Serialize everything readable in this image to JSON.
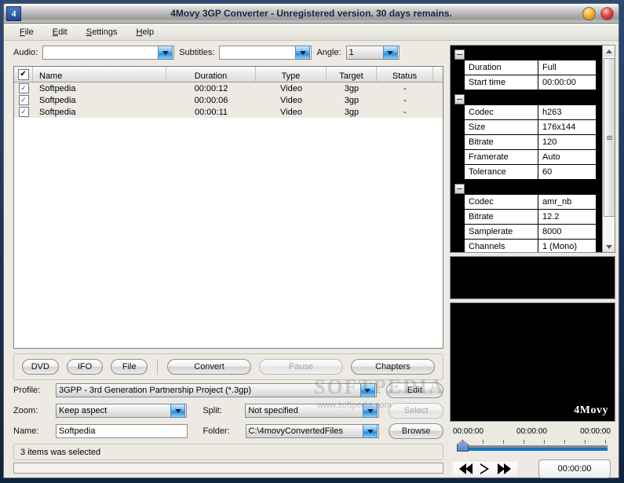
{
  "window": {
    "icon_label": "4",
    "title": "4Movy 3GP Converter - Unregistered version. 30 days remains.",
    "minimize_label": "",
    "close_label": ""
  },
  "menu": {
    "items": [
      {
        "pre": "",
        "accel": "F",
        "post": "ile"
      },
      {
        "pre": "",
        "accel": "E",
        "post": "dit"
      },
      {
        "pre": "",
        "accel": "S",
        "post": "ettings"
      },
      {
        "pre": "",
        "accel": "H",
        "post": "elp"
      }
    ]
  },
  "selectors": {
    "audio_label": "Audio:",
    "audio_value": "",
    "subtitles_label": "Subtitles:",
    "subtitles_value": "",
    "angle_label": "Angle:",
    "angle_value": "1"
  },
  "filelist": {
    "columns": [
      "Name",
      "Duration",
      "Type",
      "Target",
      "Status"
    ],
    "header_check": "✔",
    "rows": [
      {
        "checked": "✓",
        "name": "Softpedia",
        "duration": "00:00:12",
        "type": "Video",
        "target": "3gp",
        "status": "-"
      },
      {
        "checked": "✓",
        "name": "Softpedia",
        "duration": "00:00:06",
        "type": "Video",
        "target": "3gp",
        "status": "-"
      },
      {
        "checked": "✓",
        "name": "Softpedia",
        "duration": "00:00:11",
        "type": "Video",
        "target": "3gp",
        "status": "-"
      }
    ]
  },
  "actions": {
    "dvd": "DVD",
    "ifo": "IFO",
    "file": "File",
    "convert": "Convert",
    "pause": "Pause",
    "chapters": "Chapters"
  },
  "form": {
    "profile_label": "Profile:",
    "profile_value": "3GPP - 3rd Generation Partnership Project (*.3gp)",
    "edit_button": "Edit",
    "zoom_label": "Zoom:",
    "zoom_value": "Keep aspect",
    "split_label": "Split:",
    "split_value": "Not specified",
    "select_button": "Select",
    "name_label": "Name:",
    "name_value": "Softpedia",
    "folder_label": "Folder:",
    "folder_value": "C:\\4movyConvertedFiles",
    "browse_button": "Browse"
  },
  "status": {
    "message": "3 items was selected",
    "progress_percent": 0
  },
  "properties": {
    "groups": [
      {
        "collapse_glyph": "−",
        "rows": [
          {
            "key": "Duration",
            "value": "Full"
          },
          {
            "key": "Start time",
            "value": "00:00:00"
          }
        ]
      },
      {
        "collapse_glyph": "−",
        "rows": [
          {
            "key": "Codec",
            "value": "h263"
          },
          {
            "key": "Size",
            "value": "176x144"
          },
          {
            "key": "Bitrate",
            "value": "120"
          },
          {
            "key": "Framerate",
            "value": "Auto"
          },
          {
            "key": "Tolerance",
            "value": "60"
          }
        ]
      },
      {
        "collapse_glyph": "−",
        "rows": [
          {
            "key": "Codec",
            "value": "amr_nb"
          },
          {
            "key": "Bitrate",
            "value": "12.2"
          },
          {
            "key": "Samplerate",
            "value": "8000"
          },
          {
            "key": "Channels",
            "value": "1 (Mono)"
          }
        ]
      }
    ]
  },
  "player": {
    "logo": "4Movy",
    "time_left": "00:00:00",
    "time_mid": "00:00:00",
    "time_right": "00:00:00",
    "current_time": "00:00:00",
    "rewind_icon": "rewind-icon",
    "play_icon": "play-icon",
    "forward_icon": "fast-forward-icon"
  },
  "watermark": {
    "big": "SOFTPEDIA",
    "small": "www.softpedia.com"
  },
  "colors": {
    "accent_blue": "#1473c4",
    "titlebar_text": "#18283d",
    "panel_bg": "#eceae3"
  }
}
